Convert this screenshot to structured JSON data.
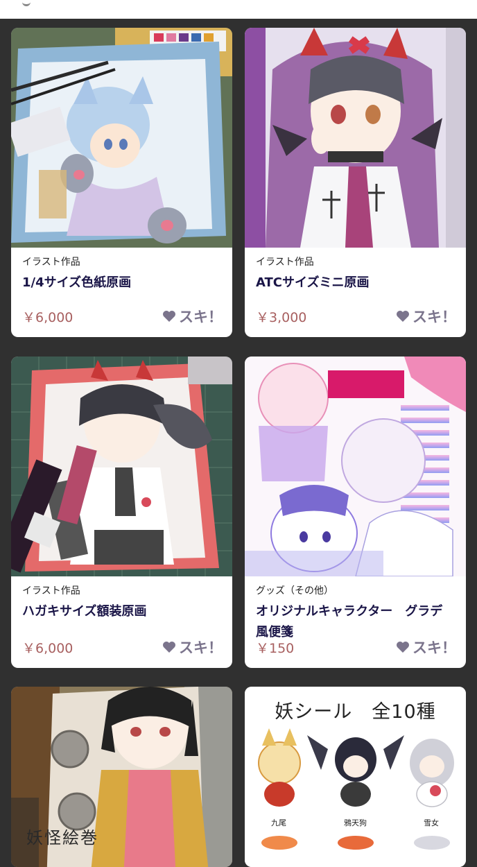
{
  "items": [
    {
      "category": "イラスト作品",
      "title": "1/4サイズ色紙原画",
      "price": "￥6,000",
      "like_label": "スキ！",
      "thumb_icon": "shikishi-illustration-photo"
    },
    {
      "category": "イラスト作品",
      "title": "ATCサイズミニ原画",
      "price": "￥3,000",
      "like_label": "スキ！",
      "thumb_icon": "atc-illustration-photo"
    },
    {
      "category": "イラスト作品",
      "title": "ハガキサイズ額装原画",
      "price": "￥6,000",
      "like_label": "スキ！",
      "thumb_icon": "postcard-illustration-photo"
    },
    {
      "category": "グッズ（その他）",
      "title": "オリジナルキャラクター　グラデ風便箋",
      "price": "￥150",
      "like_label": "スキ！",
      "thumb_icon": "letter-paper-illustration"
    },
    {
      "thumb_icon": "yokai-illustration-photo",
      "thumb_text": "妖怪絵巻"
    },
    {
      "thumb_icon": "sticker-set-illustration",
      "thumb_title": "妖シール　全10種",
      "thumb_labels": [
        "九尾",
        "鴉天狗",
        "雪女"
      ]
    }
  ],
  "colors": {
    "background": "#303030",
    "title": "#1a1547",
    "price": "#a86060",
    "like": "#7b748c"
  }
}
